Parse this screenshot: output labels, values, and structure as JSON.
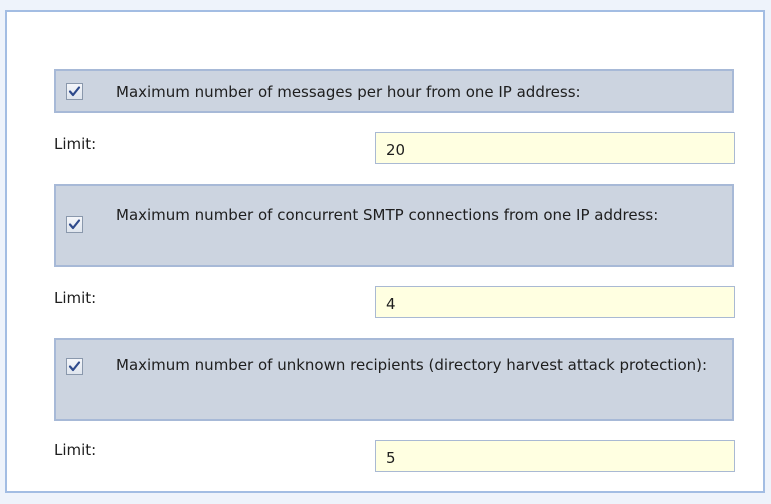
{
  "groups": [
    {
      "checked": true,
      "label": "Maximum number of messages per hour from one IP address:",
      "limit_label": "Limit:",
      "limit_value": "20"
    },
    {
      "checked": true,
      "label": "Maximum number of concurrent SMTP connections from one IP address:",
      "limit_label": "Limit:",
      "limit_value": "4"
    },
    {
      "checked": true,
      "label": "Maximum number of unknown recipients (directory harvest attack protection):",
      "limit_label": "Limit:",
      "limit_value": "5"
    }
  ],
  "colors": {
    "panel_border": "#a3bde3",
    "group_background": "#ccd4e0",
    "input_background": "#ffffe1",
    "check_mark": "#2e4a8c"
  },
  "icons": {
    "checkbox_checked": "check-mark-icon"
  }
}
